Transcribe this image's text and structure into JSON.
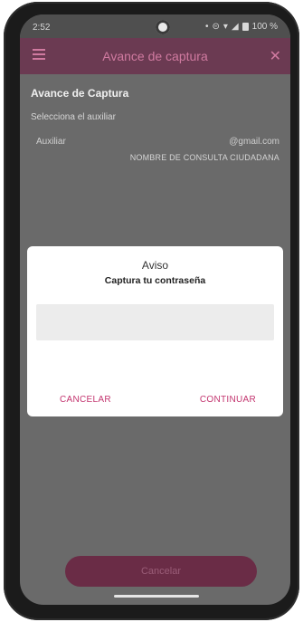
{
  "status_bar": {
    "time": "2:52",
    "battery": "100 %",
    "icons": [
      "dot-icon",
      "settings-icon",
      "wifi-icon",
      "signal-icon",
      "battery-icon"
    ]
  },
  "app_bar": {
    "title": "Avance de captura",
    "menu_icon": "menu-icon",
    "close_icon": "close-icon",
    "accent": "#d07aa0"
  },
  "content": {
    "section_title": "Avance de Captura",
    "section_subtitle": "Selecciona el auxiliar",
    "aux_label": "Auxiliar",
    "aux_email": "@gmail.com",
    "aux_name": "NOMBRE DE CONSULTA CIUDADANA"
  },
  "dialog": {
    "title": "Aviso",
    "subtitle": "Captura tu contraseña",
    "input_value": "",
    "cancel_label": "CANCELAR",
    "continue_label": "CONTINUAR",
    "button_color": "#c3356f"
  },
  "bottom_button": {
    "label": "Cancelar",
    "color": "#6a2c46"
  }
}
